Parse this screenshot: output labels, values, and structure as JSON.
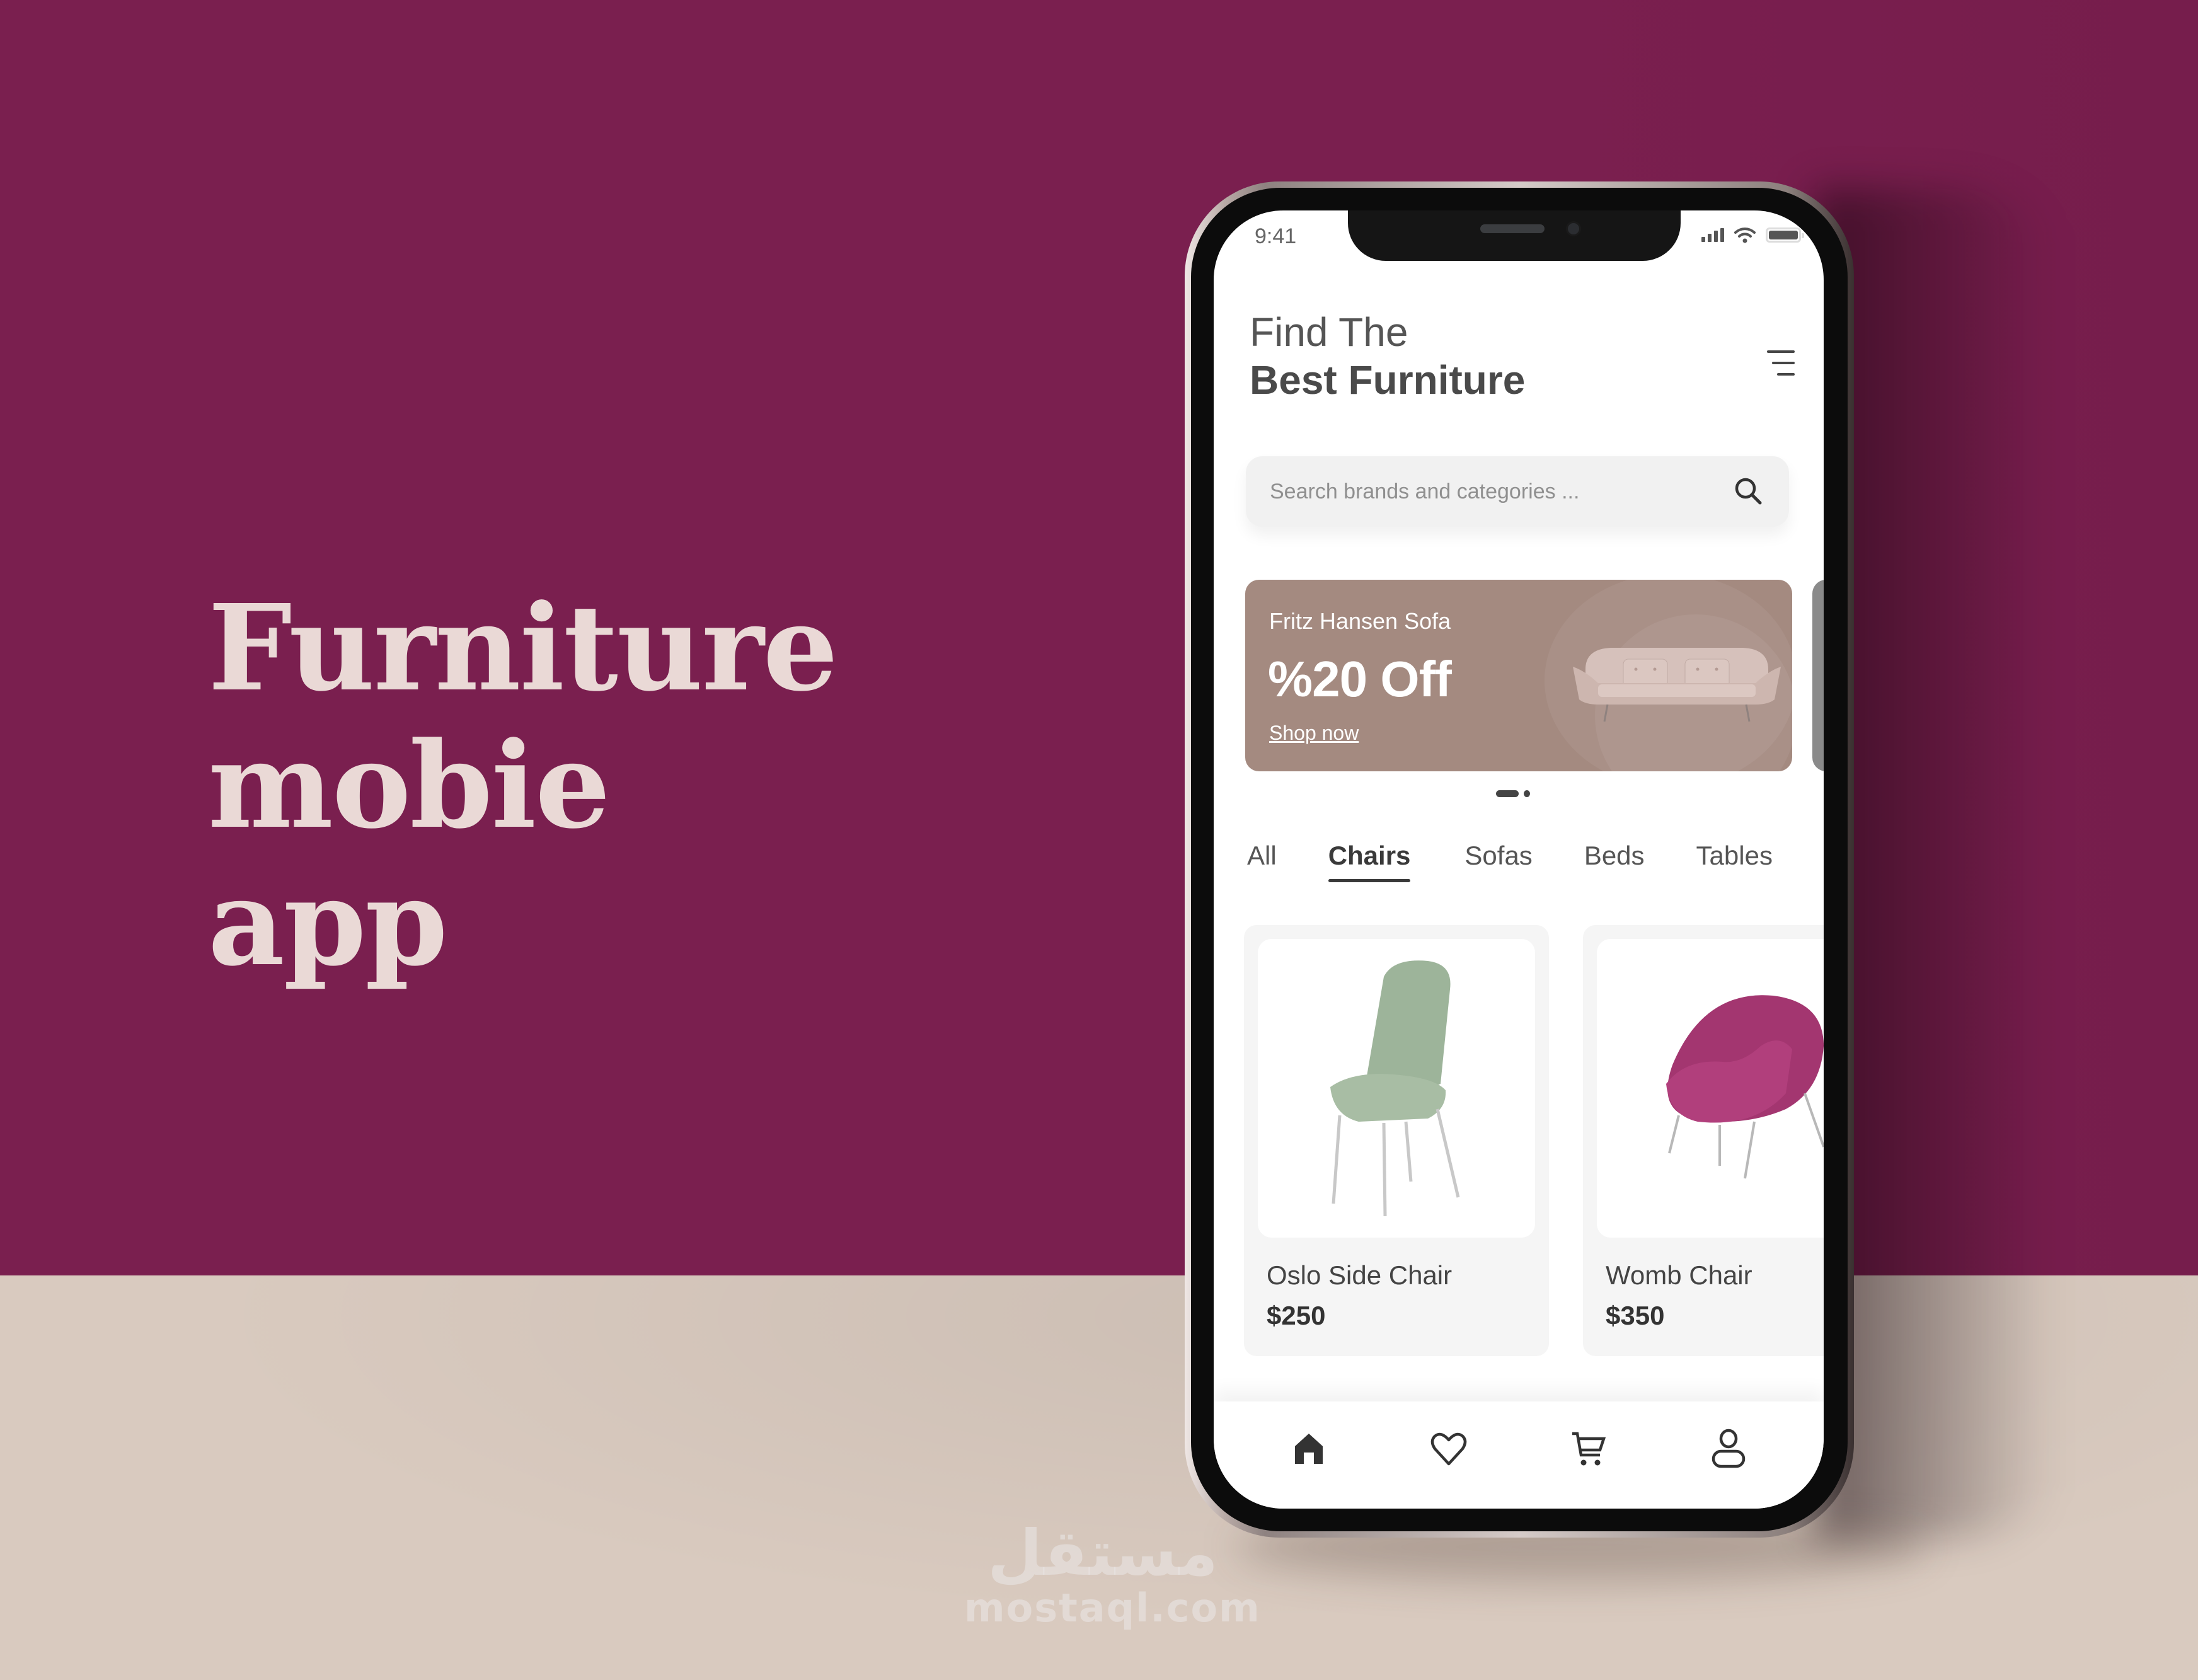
{
  "headline": {
    "line1": "Furniture mobie",
    "line2": "app"
  },
  "watermark": {
    "arabic": "مستقل",
    "latin": "mostaql.com"
  },
  "colors": {
    "wall": "#7a1f4f",
    "floor": "#d9cabf",
    "headline_text": "#ead9d6",
    "banner_bg": "#a48a80",
    "green_chair": "#9bb196",
    "womb_chair": "#a5336f"
  },
  "app": {
    "status_bar": {
      "time": "9:41",
      "icons": [
        "signal-icon",
        "wifi-icon",
        "battery-icon"
      ]
    },
    "header": {
      "title_line1": "Find The",
      "title_line2": "Best Furniture",
      "menu_icon": "menu-icon"
    },
    "search": {
      "placeholder": "Search brands and categories ...",
      "value": "",
      "icon": "search-icon"
    },
    "banner": {
      "subtitle": "Fritz Hansen Sofa",
      "title": "%20 Off",
      "link": "Shop now",
      "image": "sofa",
      "page_count": 2,
      "active_page": 1
    },
    "tabs": [
      {
        "label": "All",
        "active": false
      },
      {
        "label": "Chairs",
        "active": true
      },
      {
        "label": "Sofas",
        "active": false
      },
      {
        "label": "Beds",
        "active": false
      },
      {
        "label": "Tables",
        "active": false
      }
    ],
    "products": [
      {
        "name": "Oslo Side Chair",
        "price": "$250",
        "image": "green-side-chair"
      },
      {
        "name": "Womb Chair",
        "price": "$350",
        "image": "magenta-womb-chair"
      }
    ],
    "bottom_nav": [
      {
        "icon": "home-icon",
        "active": true
      },
      {
        "icon": "heart-icon",
        "active": false
      },
      {
        "icon": "cart-icon",
        "active": false
      },
      {
        "icon": "user-icon",
        "active": false
      }
    ]
  }
}
